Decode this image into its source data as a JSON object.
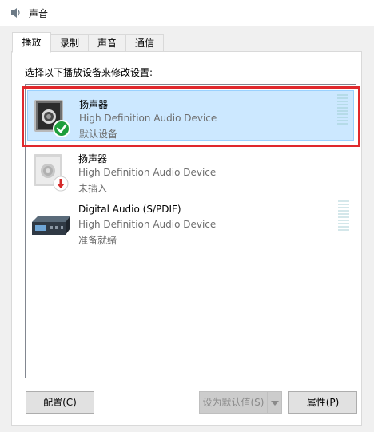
{
  "window": {
    "title": "声音",
    "icon": "speaker-icon"
  },
  "tabs": [
    {
      "label": "播放",
      "active": true
    },
    {
      "label": "录制",
      "active": false
    },
    {
      "label": "声音",
      "active": false
    },
    {
      "label": "通信",
      "active": false
    }
  ],
  "instruction": "选择以下播放设备来修改设置:",
  "devices": [
    {
      "name": "扬声器",
      "description": "High Definition Audio Device",
      "status": "默认设备",
      "icon": "speaker-icon",
      "badge": "default-check-icon",
      "selected": true
    },
    {
      "name": "扬声器",
      "description": "High Definition Audio Device",
      "status": "未插入",
      "icon": "speaker-icon",
      "badge": "unplugged-arrow-icon",
      "selected": false
    },
    {
      "name": "Digital Audio (S/PDIF)",
      "description": "High Definition Audio Device",
      "status": "准备就绪",
      "icon": "digital-audio-receiver-icon",
      "badge": "",
      "selected": false
    }
  ],
  "buttons": {
    "configure": "配置(C)",
    "set_default": "设为默认值(S)",
    "properties": "属性(P)"
  },
  "colors": {
    "selection": "#cce8ff",
    "selection_border": "#99d1ff",
    "highlight_annotation": "#e0292d",
    "default_badge": "#1e9e3c",
    "unplugged_badge": "#d52a2a"
  }
}
